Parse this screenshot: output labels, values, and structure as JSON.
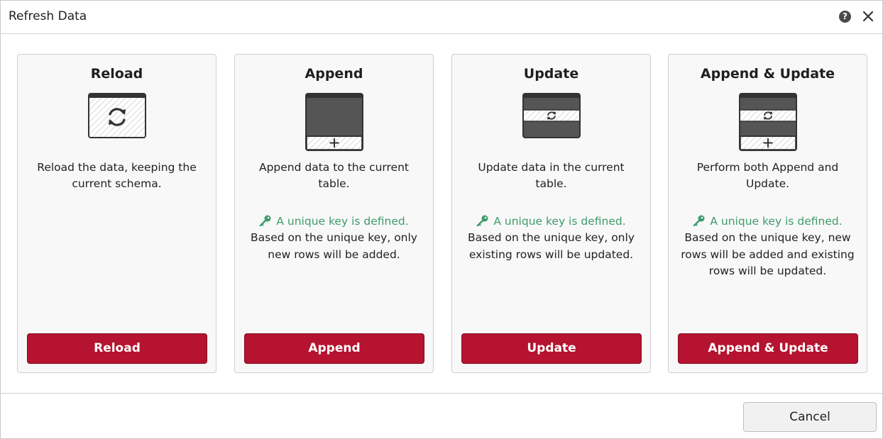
{
  "dialog": {
    "title": "Refresh Data",
    "help_icon": "help-icon",
    "close_icon": "close-icon"
  },
  "cards": [
    {
      "title": "Reload",
      "icon": "reload-table-icon",
      "description": "Reload the data, keeping the current schema.",
      "key_status": "",
      "key_note": "",
      "button_label": "Reload"
    },
    {
      "title": "Append",
      "icon": "append-table-icon",
      "description": "Append data to the current table.",
      "key_status": "A unique key is defined.",
      "key_note": "Based on the unique key, only new rows will be added.",
      "button_label": "Append"
    },
    {
      "title": "Update",
      "icon": "update-table-icon",
      "description": "Update data in the current table.",
      "key_status": "A unique key is defined.",
      "key_note": "Based on the unique key, only existing rows will be updated.",
      "button_label": "Update"
    },
    {
      "title": "Append & Update",
      "icon": "append-update-table-icon",
      "description": "Perform both Append and Update.",
      "key_status": "A unique key is defined.",
      "key_note": "Based on the unique key, new rows will be added and existing rows will be updated.",
      "button_label": "Append & Update"
    }
  ],
  "footer": {
    "cancel_label": "Cancel"
  },
  "colors": {
    "primary_button": "#b5132f",
    "key_text": "#3e9b6a",
    "icon_dark": "#555555"
  }
}
